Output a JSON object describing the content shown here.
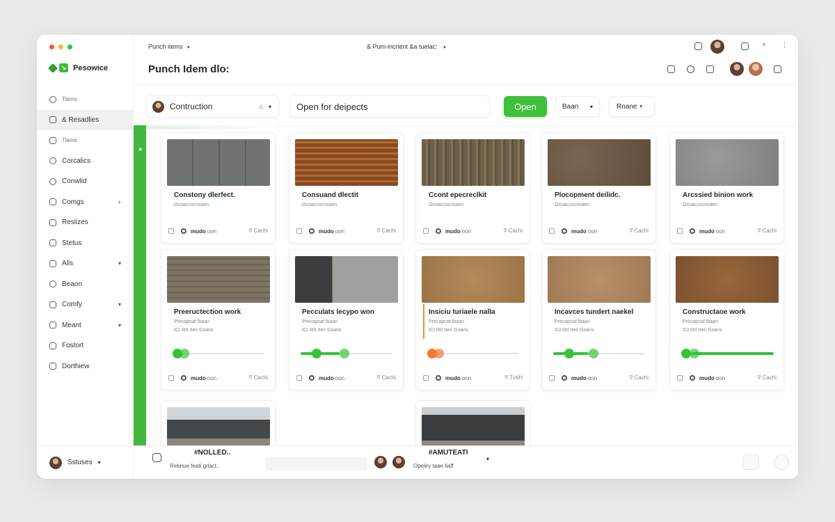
{
  "window": {
    "traffic_colors": [
      "#f2563b",
      "#f5b826",
      "#36c13a"
    ]
  },
  "sidebar": {
    "brand": "Pesowice",
    "items": [
      {
        "label": "Tlams",
        "icon": "clock-icon",
        "small": true
      },
      {
        "label": "& Resadlies",
        "icon": "layers-icon",
        "active": true
      },
      {
        "label": "Tlams",
        "icon": "list-icon",
        "small": true
      },
      {
        "label": "Corcalics",
        "icon": "search-icon"
      },
      {
        "label": "Conwlid",
        "icon": "search-icon"
      },
      {
        "label": "Comgs",
        "icon": "grid-icon",
        "expand": "+"
      },
      {
        "label": "Reslizes",
        "icon": "tag-icon"
      },
      {
        "label": "Stetus",
        "icon": "grid-icon"
      },
      {
        "label": "Alls",
        "icon": "grid-icon",
        "expand": "▾"
      },
      {
        "label": "Beaon",
        "icon": "circle-icon"
      },
      {
        "label": "Comfy",
        "icon": "note-icon",
        "expand": "▾"
      },
      {
        "label": "Meant",
        "icon": "note-icon",
        "expand": "▾"
      },
      {
        "label": "Fostort",
        "icon": "note-icon"
      },
      {
        "label": "Dorthiew",
        "icon": "note-icon"
      }
    ],
    "footer_label": "Sstuses"
  },
  "topbar": {
    "crumb": "Punch items",
    "title": "Punch Idem dlo:",
    "center_crumb": "& Pum-incrient &a tuelac:"
  },
  "filters": {
    "project": "Contruction",
    "search": "Open for deipects",
    "open_button": "Open",
    "select1": "Baan",
    "select2": "Rnane"
  },
  "cards": [
    {
      "title": "Constony dlerfect.",
      "sub": "Ocoaccocnsaen",
      "user": "mudo",
      "user_suffix": "oon",
      "right": "⩢ Cachi",
      "img": "stone"
    },
    {
      "title": "Consuand dlectit",
      "sub": "Ocoaccocnsaen",
      "user": "mudo",
      "user_suffix": "oon",
      "right": "⩢ Cachi",
      "img": "window"
    },
    {
      "title": "Ccont epecreclkit",
      "sub": "Ocoaccocnsaen",
      "user": "mudo",
      "user_suffix": "oon",
      "right": "⩢ Cachi",
      "img": "wood"
    },
    {
      "title": "Plocopment deilidc.",
      "sub": "Ocoaccocnsaen",
      "user": "mudo",
      "user_suffix": "oon",
      "right": "⩢ Cachi",
      "img": "soil"
    },
    {
      "title": "Arcssied binion work",
      "sub": "Ocoaccocnsaen",
      "user": "mudo",
      "user_suffix": "oon",
      "right": "⩢ Cachi",
      "img": "concrete"
    },
    {
      "title": "Preeructection work",
      "sub": "Precapnaf lbaan",
      "sub2": "ICI IIIII Iten Goans",
      "progress": 0.06,
      "user": "mudo",
      "user_suffix": "oon",
      "right": "⩢ Cachi",
      "img": "siding",
      "color": "#34c438"
    },
    {
      "title": "Pecculats lecypo won",
      "sub": "Precapnaf lbaan",
      "sub2": "ICI IIIII Iten Goans",
      "progress": 0.42,
      "user": "mudo",
      "user_suffix": "oon",
      "right": "⩢ Cachi",
      "img": "facade",
      "color": "#34c438"
    },
    {
      "title": "Insiciu turiaele nalla",
      "sub": "Precapnaf lbaan",
      "sub2": "ICI IIIII Iten Goans",
      "progress": 0.0,
      "user": "mudo",
      "user_suffix": "oon",
      "right": "⩢ TvtiH",
      "img": "sand",
      "color": "#f07a2e",
      "accent": true
    },
    {
      "title": "Incavces tundert naekel",
      "sub": "Precapnaf lbaan",
      "sub2": "ICI IIIII Iten Goans",
      "progress": 0.38,
      "user": "mudo",
      "user_suffix": "oon",
      "right": "⩢ Cachi",
      "img": "sand2",
      "color": "#34c438"
    },
    {
      "title": "Constructaoe work",
      "sub": "Precapnaf lbaan",
      "sub2": "ICI IIIII Iten Goans",
      "progress": 1.0,
      "user": "mudo",
      "user_suffix": "oon",
      "right": "⩢ Cachi",
      "img": "brick",
      "color": "#34c438"
    },
    {
      "title": "",
      "img": "building"
    },
    {
      "title": "",
      "img": "building2"
    }
  ],
  "bottombar": {
    "left_label": "Rebnue feati grlact..",
    "center_tag": "#NOLLED..",
    "center_tag2": "#AMUTEATI",
    "center_sub": "Opeiiry taae liaff"
  },
  "colors": {
    "accent_green": "#3fbf3b",
    "accent_orange": "#f07a2e"
  }
}
